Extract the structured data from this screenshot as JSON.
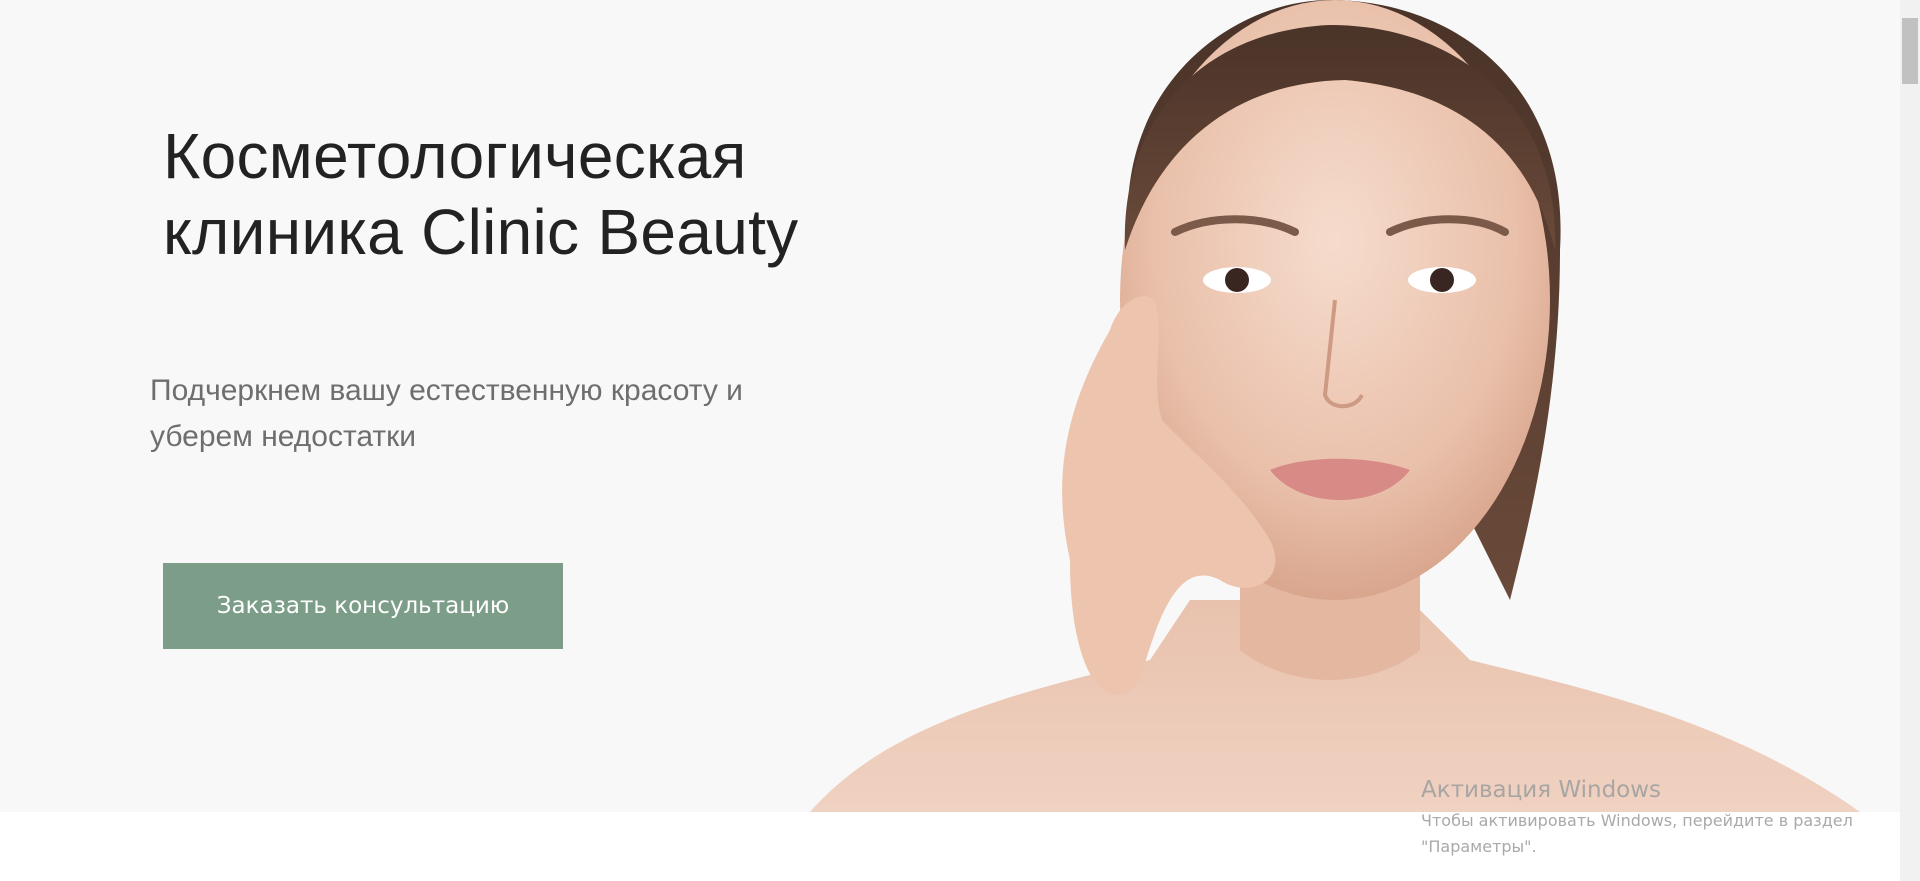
{
  "hero": {
    "title_line1": "Косметологическая",
    "title_line2": "клиника Clinic Beauty",
    "subtitle_line1": "Подчеркнем вашу естественную красоту и",
    "subtitle_line2": "уберем недостатки",
    "cta_label": "Заказать консультацию",
    "image_subject": "woman-portrait"
  },
  "watermark": {
    "title": "Активация Windows",
    "line1": "Чтобы активировать Windows, перейдите в раздел",
    "line2": "\"Параметры\"."
  },
  "colors": {
    "hero_background": "#f8f8f8",
    "cta_background": "#7c9d87",
    "title_text": "#222222",
    "subtitle_text": "#6e6e6e"
  }
}
